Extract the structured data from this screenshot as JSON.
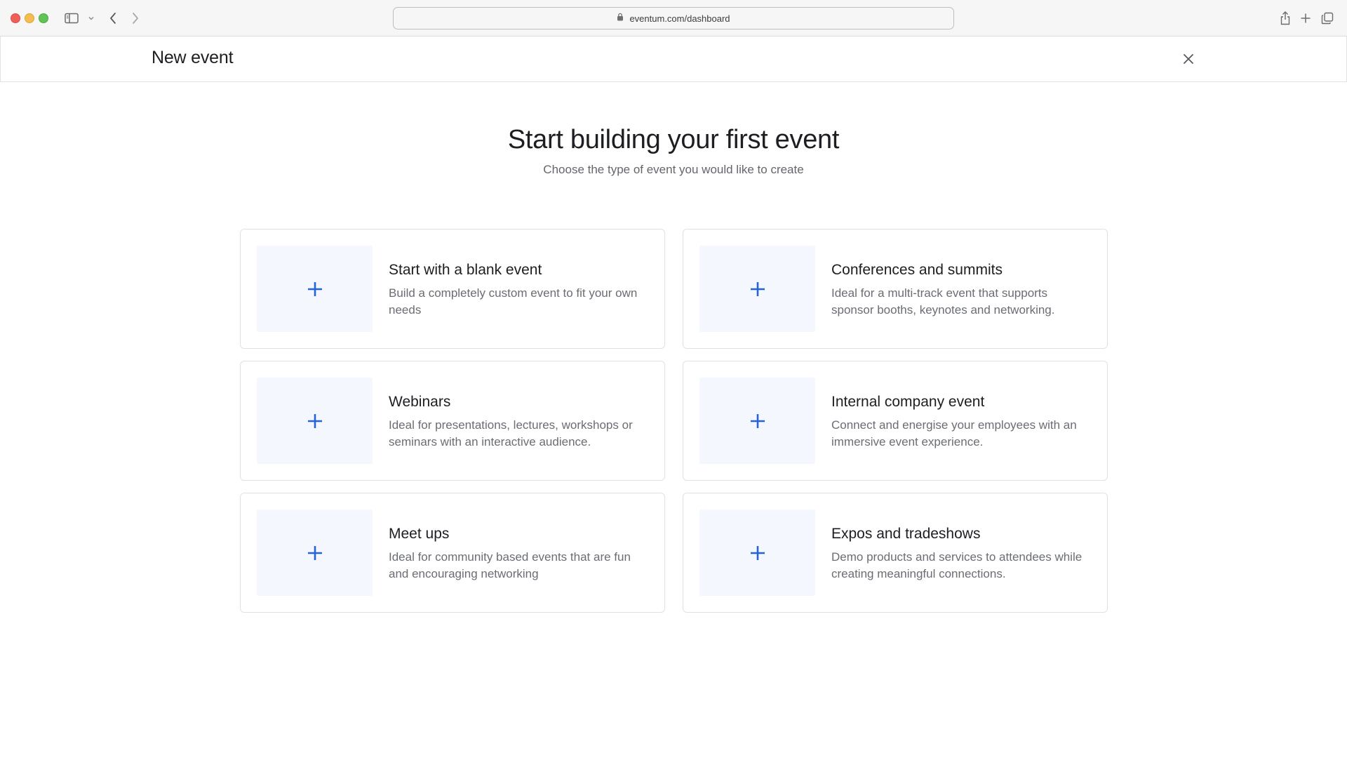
{
  "browser": {
    "url": "eventum.com/dashboard",
    "icons": [
      "sidebar-icon",
      "chevron-down-icon",
      "back-icon",
      "forward-icon",
      "lock-icon",
      "share-icon",
      "new-tab-icon",
      "tabs-overview-icon"
    ]
  },
  "modal": {
    "title": "New event",
    "close_icon": "close-icon"
  },
  "intro": {
    "heading": "Start building your first event",
    "subheading": "Choose the type of event you would like to create"
  },
  "event_types": [
    {
      "title": "Start with a blank event",
      "description": "Build a completely custom event to fit your own needs",
      "icon": "plus-icon"
    },
    {
      "title": "Conferences and summits",
      "description": "Ideal for a multi-track event that supports sponsor booths, keynotes and networking.",
      "icon": "plus-icon"
    },
    {
      "title": "Webinars",
      "description": "Ideal for presentations, lectures, workshops or seminars with an interactive audience.",
      "icon": "plus-icon"
    },
    {
      "title": "Internal company event",
      "description": "Connect and energise your employees with an immersive event experience.",
      "icon": "plus-icon"
    },
    {
      "title": "Meet ups",
      "description": "Ideal for community based events that are fun and encouraging networking",
      "icon": "plus-icon"
    },
    {
      "title": "Expos and tradeshows",
      "description": "Demo products and services to attendees while creating meaningful connections.",
      "icon": "plus-icon"
    }
  ],
  "colors": {
    "accent": "#2563d9",
    "thumb_bg": "#f4f7fd",
    "card_border": "#e0e1e4"
  }
}
